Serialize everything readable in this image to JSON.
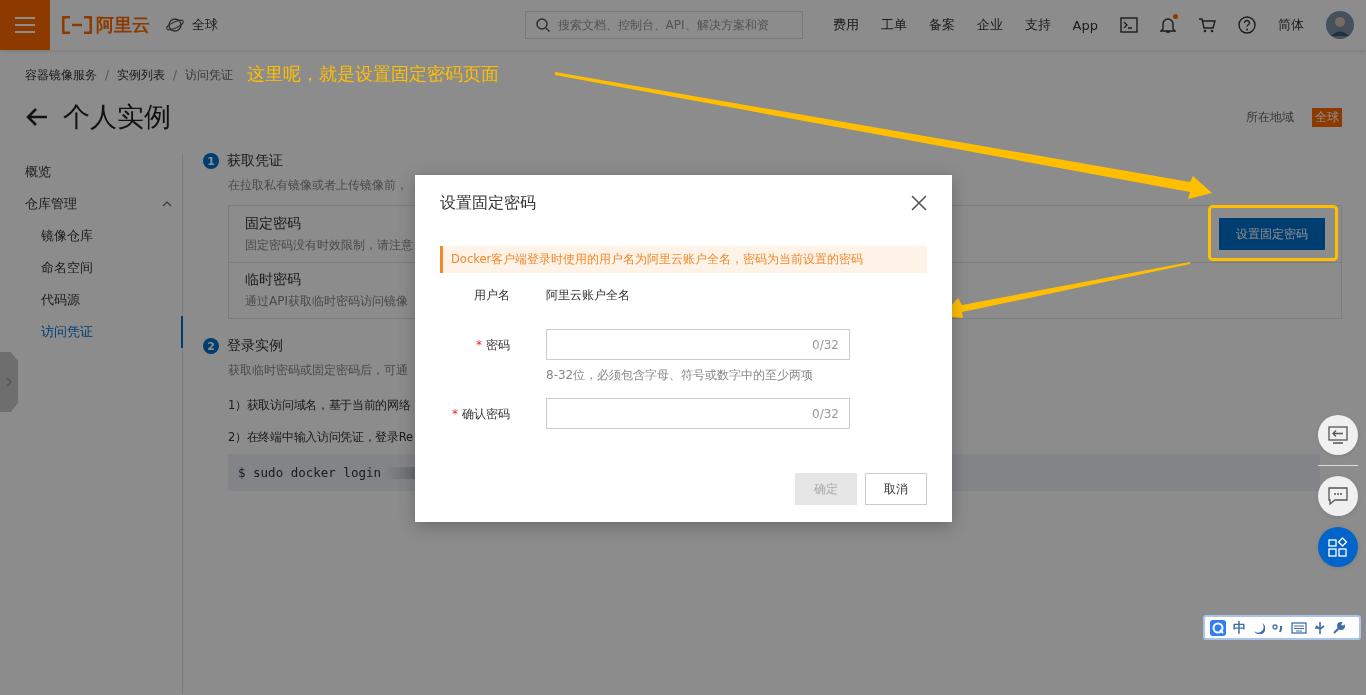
{
  "topbar": {
    "brand": "阿里云",
    "region": "全球",
    "search": {
      "placeholder": "搜索文档、控制台、API、解决方案和资"
    },
    "links": [
      {
        "label": "费用"
      },
      {
        "label": "工单"
      },
      {
        "label": "备案"
      },
      {
        "label": "企业"
      },
      {
        "label": "支持"
      },
      {
        "label": "App"
      }
    ],
    "unread_notifications": true,
    "language": "简体"
  },
  "breadcrumb": {
    "separator": "/",
    "items": [
      "容器镜像服务",
      "实例列表",
      "访问凭证"
    ]
  },
  "page": {
    "title": "个人实例",
    "region_label": "所在地域",
    "region": "全球"
  },
  "sidebar": {
    "items": [
      {
        "label": "概览",
        "selected": false
      },
      {
        "label": "仓库管理",
        "selected": false,
        "expanded": true,
        "children": [
          {
            "label": "镜像仓库",
            "selected": false
          },
          {
            "label": "命名空间",
            "selected": false
          },
          {
            "label": "代码源",
            "selected": false
          },
          {
            "label": "访问凭证",
            "selected": true
          }
        ]
      }
    ]
  },
  "steps": [
    {
      "number": "1",
      "title": "获取凭证",
      "description": "在拉取私有镜像或者上传镜像前，",
      "options": [
        {
          "title": "固定密码",
          "description": "固定密码没有时效限制，请注意",
          "action": "设置固定密码"
        },
        {
          "title": "临时密码",
          "description": "通过API获取临时密码访问镜像"
        }
      ]
    },
    {
      "number": "2",
      "title": "登录实例",
      "description": "获取临时密码或固定密码后，可通",
      "instructions": [
        "1）获取访问域名，基于当前的网络",
        "2）在终端中输入访问凭证，登录Re"
      ],
      "code": "$ sudo docker login"
    }
  ],
  "dialog": {
    "title": "设置固定密码",
    "alert": "Docker客户端登录时使用的用户名为阿里云账户全名，密码为当前设置的密码",
    "fields": [
      {
        "kind": "text",
        "label": "用户名",
        "value": "阿里云账户全名"
      },
      {
        "kind": "input",
        "label": "密码",
        "required_mark": "*",
        "counter": "0/32",
        "help": "8-32位，必须包含字母、符号或数字中的至少两项"
      },
      {
        "kind": "input",
        "label": "确认密码",
        "required_mark": "*",
        "counter": "0/32"
      }
    ],
    "buttons": [
      {
        "label": "确定",
        "primary": true,
        "disabled": true
      },
      {
        "label": "取消",
        "primary": false,
        "disabled": false
      }
    ]
  },
  "annotation": {
    "caption": "这里呢，就是设置固定密码页面"
  },
  "ime": {
    "mode": "中"
  }
}
